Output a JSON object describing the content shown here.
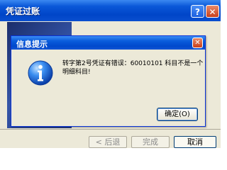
{
  "parent_window": {
    "title": "凭证过账",
    "help_label": "?",
    "close_label": "✕",
    "buttons": {
      "back": "< 后退",
      "finish": "完成",
      "cancel": "取消"
    }
  },
  "dialog": {
    "title": "信息提示",
    "close_label": "✕",
    "message": "转字第2号凭证有错误：60010101 科目不是一个明细科目!",
    "ok_label": "确定(O)",
    "icon": "information-icon"
  },
  "colors": {
    "titlebar_blue": "#0a57d8",
    "dialog_bg": "#ece9d8",
    "close_red": "#c8401d"
  }
}
